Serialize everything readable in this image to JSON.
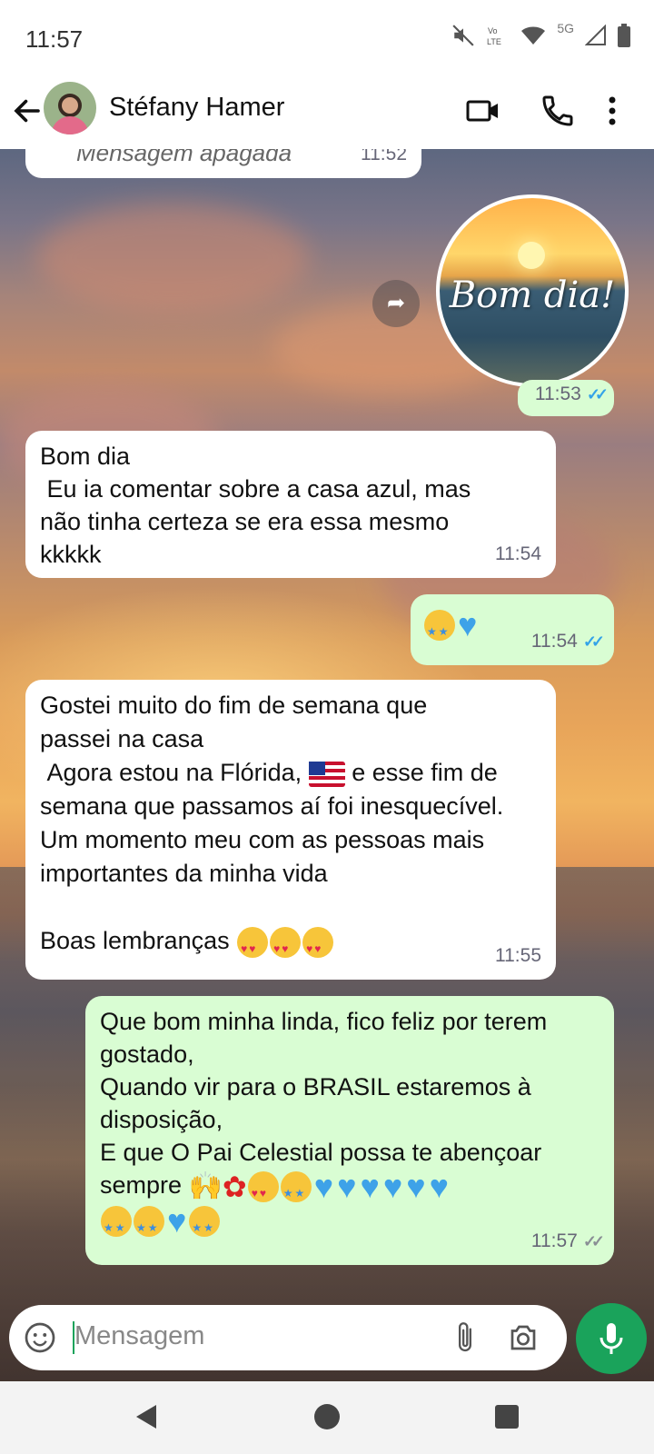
{
  "status_bar": {
    "time": "11:57",
    "network": "5G",
    "icons": [
      "mute-icon",
      "volte-icon",
      "wifi-icon",
      "signal-icon",
      "battery-icon"
    ]
  },
  "header": {
    "contact_name": "Stéfany Hamer",
    "icons": [
      "back-arrow-icon",
      "avatar",
      "video-call-icon",
      "phone-icon",
      "more-options-icon"
    ]
  },
  "messages": [
    {
      "id": "m0",
      "direction": "in",
      "text": "Mensagem apagada",
      "time": "11:52",
      "deleted": true
    },
    {
      "id": "m1",
      "direction": "out",
      "type": "sticker",
      "sticker_text": "Bom dia!",
      "time": "11:53",
      "status": "read"
    },
    {
      "id": "m2",
      "direction": "in",
      "text": "Bom dia\n Eu ia comentar sobre a casa azul, mas\nnão tinha certeza se era essa mesmo\nkkkkk",
      "time": "11:54"
    },
    {
      "id": "m3",
      "direction": "out",
      "emojis": [
        "star-struck",
        "blue-heart"
      ],
      "time": "11:54",
      "status": "read"
    },
    {
      "id": "m4",
      "direction": "in",
      "text_part1": "Gostei muito do fim de semana que\npassei na casa\n Agora estou na Flórida, ",
      "text_part2": " e esse fim de\nsemana que passamos aí foi inesquecível.\nUm momento meu com as pessoas mais\nimportantes da minha vida\n\nBoas lembranças ",
      "emojis": [
        "us-flag",
        "heart-eyes",
        "heart-eyes",
        "heart-eyes"
      ],
      "time": "11:55"
    },
    {
      "id": "m5",
      "direction": "out",
      "text": "Que bom minha linda, fico feliz por terem\ngostado,\nQuando vir para o BRASIL estaremos à\ndisposição,\nE que O Pai Celestial possa te abençoar\nsempre ",
      "emojis": [
        "raising-hands",
        "rose",
        "heart-eyes",
        "star-struck",
        "blue-heart",
        "blue-heart",
        "blue-heart",
        "blue-heart",
        "blue-heart",
        "blue-heart",
        "star-struck",
        "star-struck",
        "blue-heart",
        "star-struck"
      ],
      "time": "11:57",
      "status": "delivered"
    }
  ],
  "input": {
    "placeholder": "Mensagem"
  },
  "colors": {
    "accent": "#1aa35b",
    "outgoing_bubble": "#d9fdd3",
    "incoming_bubble": "#ffffff",
    "read_ticks": "#34a3e8"
  }
}
